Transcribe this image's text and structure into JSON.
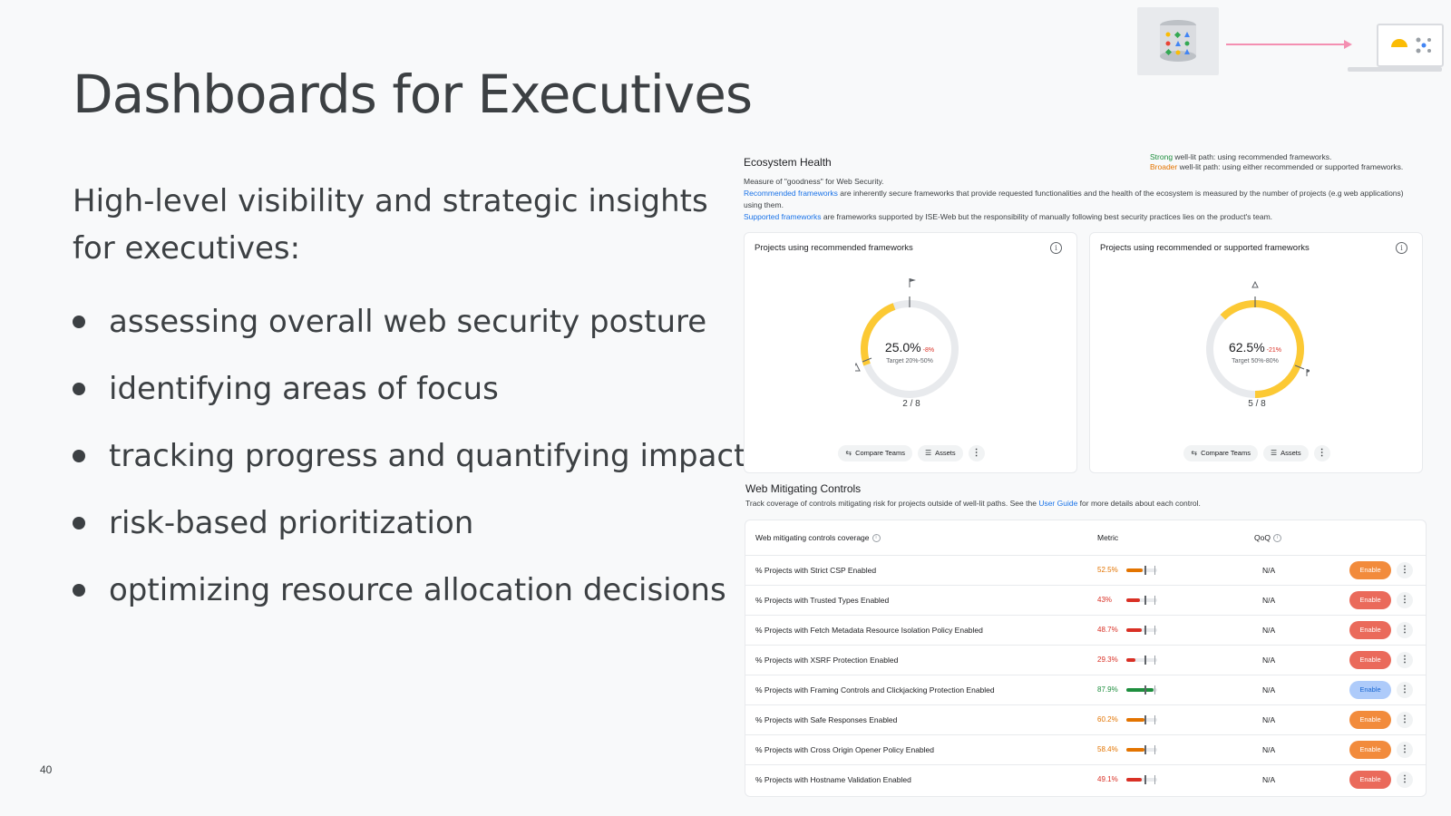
{
  "slide": {
    "title": "Dashboards for Executives",
    "subtitle": "High-level visibility and strategic insights for executives:",
    "bullets": [
      "assessing overall web security posture",
      "identifying areas of focus",
      "tracking progress and quantifying impact",
      "risk-based prioritization",
      "optimizing resource allocation decisions"
    ],
    "page_number": "40"
  },
  "dashboard": {
    "ecosystem": {
      "title": "Ecosystem Health",
      "legend_strong_label": "Strong",
      "legend_strong_text": " well-lit path: using recommended frameworks.",
      "legend_broader_label": "Broader",
      "legend_broader_text": " well-lit path: using either recommended or supported frameworks.",
      "desc_line1": "Measure of \"goodness\" for Web Security.",
      "desc_link1": "Recommended frameworks",
      "desc_line2": " are inherently secure frameworks that provide requested functionalities and the health of the ecosystem is measured by the number of projects (e.g web applications) using them.",
      "desc_link2": "Supported frameworks",
      "desc_line3": " are frameworks supported by ISE-Web but the responsibility of manually following best security practices lies on the product's team."
    },
    "cards": [
      {
        "title": "Projects using recommended frameworks",
        "value": "25.0%",
        "delta": "-8%",
        "target": "Target 20%-50%",
        "count": "2 / 8",
        "fraction": 0.25,
        "compare_label": "Compare Teams",
        "assets_label": "Assets"
      },
      {
        "title": "Projects using recommended or supported frameworks",
        "value": "62.5%",
        "delta": "-21%",
        "target": "Target 50%-80%",
        "count": "5 / 8",
        "fraction": 0.625,
        "compare_label": "Compare Teams",
        "assets_label": "Assets"
      }
    ],
    "mitigating": {
      "title": "Web Mitigating Controls",
      "desc_pre": "Track coverage of controls mitigating risk for projects outside of well-lit paths. See the ",
      "desc_link": "User Guide",
      "desc_post": " for more details about each control.",
      "headers": {
        "coverage": "Web mitigating controls coverage",
        "metric": "Metric",
        "qoq": "QoQ"
      },
      "rows": [
        {
          "name": "% Projects with Strict CSP Enabled",
          "metric": "52.5%",
          "fraction": 0.525,
          "color": "#e37400",
          "qoq": "N/A",
          "button": "Enable",
          "btn_color": "#f28b3c"
        },
        {
          "name": "% Projects with Trusted Types Enabled",
          "metric": "43%",
          "fraction": 0.43,
          "color": "#d93025",
          "qoq": "N/A",
          "button": "Enable",
          "btn_color": "#ea6a5b"
        },
        {
          "name": "% Projects with Fetch Metadata Resource Isolation Policy Enabled",
          "metric": "48.7%",
          "fraction": 0.487,
          "color": "#d93025",
          "qoq": "N/A",
          "button": "Enable",
          "btn_color": "#ea6a5b"
        },
        {
          "name": "% Projects with XSRF Protection Enabled",
          "metric": "29.3%",
          "fraction": 0.293,
          "color": "#d93025",
          "qoq": "N/A",
          "button": "Enable",
          "btn_color": "#ea6a5b"
        },
        {
          "name": "% Projects with Framing Controls and Clickjacking Protection Enabled",
          "metric": "87.9%",
          "fraction": 0.879,
          "color": "#1e8e3e",
          "qoq": "N/A",
          "button": "Enable",
          "btn_color": "#aecbfa"
        },
        {
          "name": "% Projects with Safe Responses Enabled",
          "metric": "60.2%",
          "fraction": 0.602,
          "color": "#e37400",
          "qoq": "N/A",
          "button": "Enable",
          "btn_color": "#f28b3c"
        },
        {
          "name": "% Projects with Cross Origin Opener Policy Enabled",
          "metric": "58.4%",
          "fraction": 0.584,
          "color": "#e37400",
          "qoq": "N/A",
          "button": "Enable",
          "btn_color": "#f28b3c"
        },
        {
          "name": "% Projects with Hostname Validation Enabled",
          "metric": "49.1%",
          "fraction": 0.491,
          "color": "#d93025",
          "qoq": "N/A",
          "button": "Enable",
          "btn_color": "#ea6a5b"
        }
      ]
    }
  },
  "colors": {
    "gauge_fill": "#fcc934",
    "gauge_track": "#e8eaed",
    "link": "#1a73e8"
  }
}
